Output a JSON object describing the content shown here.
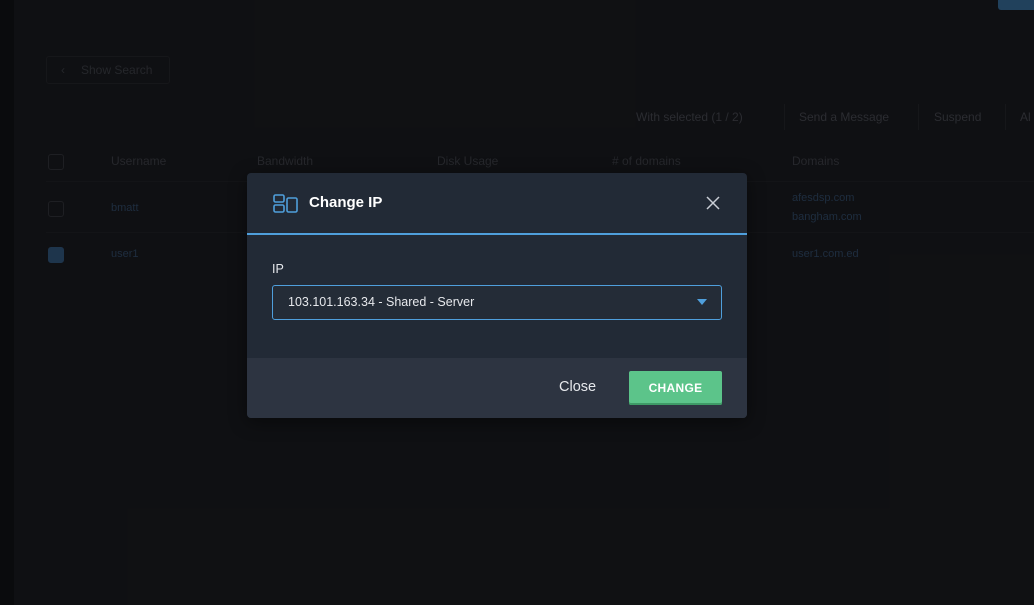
{
  "background": {
    "show_search": "Show Search",
    "toolbar": [
      "With selected (1 / 2)",
      "Send a Message",
      "Suspend",
      "Al"
    ],
    "table_headers": [
      "Username",
      "Bandwidth",
      "Disk Usage",
      "# of domains",
      "Domains"
    ],
    "rows": [
      {
        "username": "bmatt",
        "domains": [
          "afesdsp.com",
          "bangham.com"
        ],
        "checked": false
      },
      {
        "username": "user1",
        "domains": [
          "user1.com.ed"
        ],
        "checked": true
      }
    ]
  },
  "modal": {
    "title": "Change IP",
    "field_label": "IP",
    "selected_ip": "103.101.163.34 - Shared - Server",
    "close_label": "Close",
    "change_label": "CHANGE"
  },
  "colors": {
    "accent": "#4f9fdc",
    "primary_button": "#5cc48a",
    "modal_bg": "#222a36",
    "footer_bg": "#2d3441"
  },
  "icons": {
    "title_icon": "change-ip-icon",
    "close_icon": "close-icon",
    "caret_icon": "caret-down-icon"
  }
}
